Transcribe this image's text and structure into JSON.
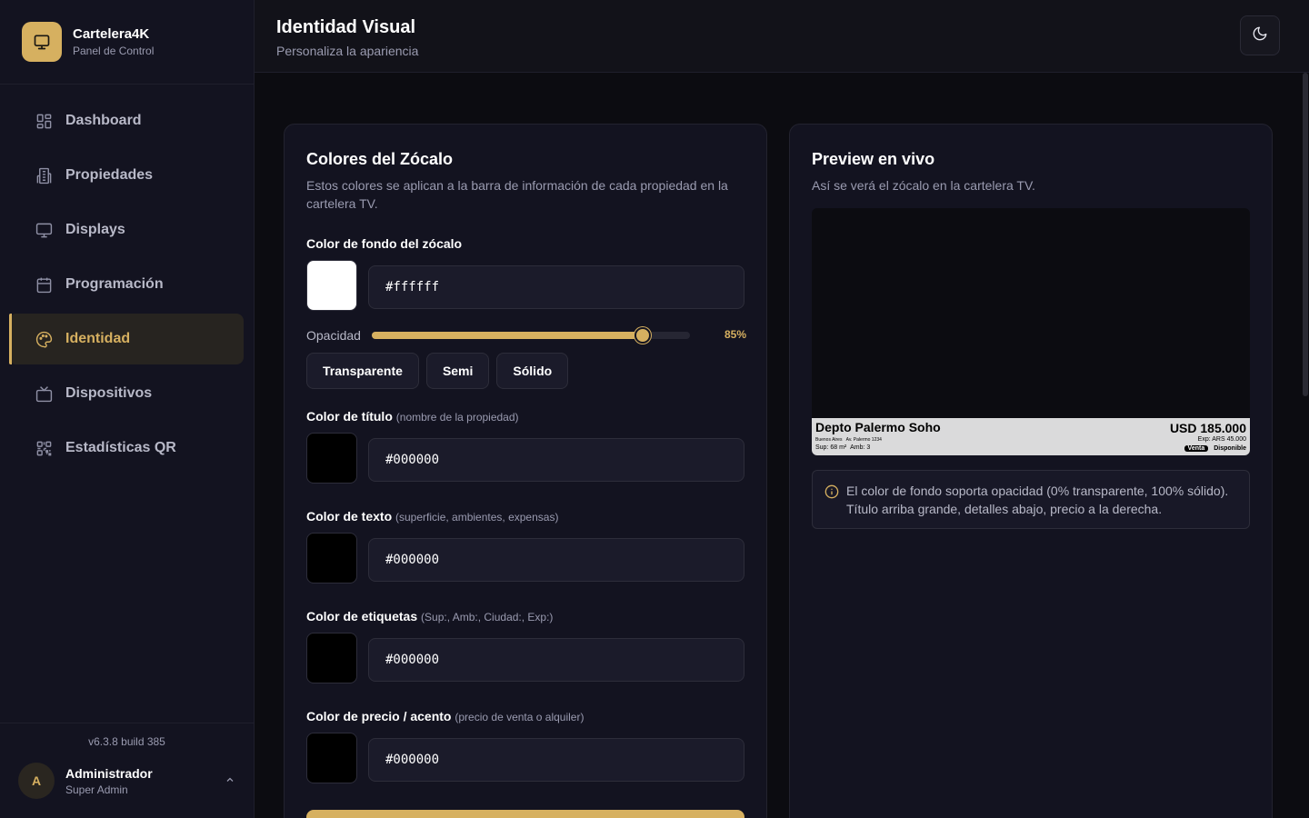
{
  "app": {
    "name": "Cartelera4K",
    "subtitle": "Panel de Control"
  },
  "sidebar": {
    "items": [
      {
        "label": "Dashboard",
        "icon": "grid-icon",
        "active": false
      },
      {
        "label": "Propiedades",
        "icon": "building-icon",
        "active": false
      },
      {
        "label": "Displays",
        "icon": "monitor-icon",
        "active": false
      },
      {
        "label": "Programación",
        "icon": "calendar-icon",
        "active": false
      },
      {
        "label": "Identidad",
        "icon": "palette-icon",
        "active": true
      },
      {
        "label": "Dispositivos",
        "icon": "tv-icon",
        "active": false
      },
      {
        "label": "Estadísticas QR",
        "icon": "qr-code-icon",
        "active": false
      }
    ],
    "version": "v6.3.8 build 385",
    "user": {
      "initial": "A",
      "name": "Administrador",
      "role": "Super Admin"
    }
  },
  "header": {
    "title": "Identidad Visual",
    "subtitle": "Personaliza la apariencia"
  },
  "colors_card": {
    "title": "Colores del Zócalo",
    "description": "Estos colores se aplican a la barra de información de cada propiedad en la cartelera TV.",
    "background": {
      "label": "Color de fondo del zócalo",
      "value": "#ffffff"
    },
    "opacity": {
      "label": "Opacidad",
      "value_text": "85%",
      "value": 0.85
    },
    "presets": [
      "Transparente",
      "Semi",
      "Sólido"
    ],
    "title_color": {
      "label": "Color de título",
      "hint": "(nombre de la propiedad)",
      "value": "#000000"
    },
    "text_color": {
      "label": "Color de texto",
      "hint": "(superficie, ambientes, expensas)",
      "value": "#000000"
    },
    "tags_color": {
      "label": "Color de etiquetas",
      "hint": "(Sup:, Amb:, Ciudad:, Exp:)",
      "value": "#000000"
    },
    "price_color": {
      "label": "Color de precio / acento",
      "hint": "(precio de venta o alquiler)",
      "value": "#000000"
    }
  },
  "preview_card": {
    "title": "Preview en vivo",
    "description": "Así se verá el zócalo en la cartelera TV.",
    "zocalo": {
      "title": "Depto Palermo Soho",
      "city": "Buenos Aires",
      "address": "Av. Palermo 1234",
      "surface": "Sup: 68 m²",
      "rooms": "Amb: 3",
      "price": "USD 185.000",
      "expenses": "Exp: ARS 45.000",
      "badge_operation": "Venta",
      "badge_status": "Disponible"
    },
    "info": "El color de fondo soporta opacidad (0% transparente, 100% sólido). Título arriba grande, detalles abajo, precio a la derecha."
  },
  "theme": {
    "accent": "#d6b060",
    "background": "#0c0c11",
    "panel": "#131320"
  }
}
